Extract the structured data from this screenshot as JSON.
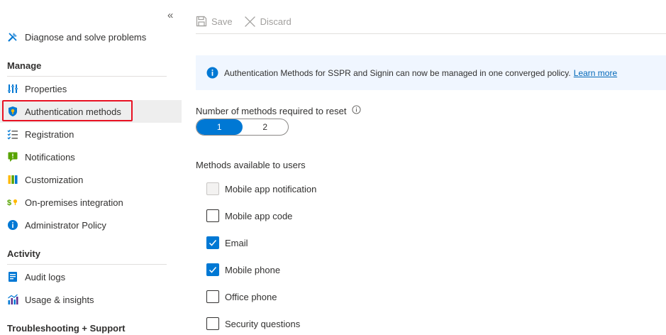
{
  "sidebar": {
    "items": [
      {
        "label": "Diagnose and solve problems",
        "icon": "diagnose-icon"
      },
      {
        "label": "Properties",
        "icon": "properties-icon"
      },
      {
        "label": "Authentication methods",
        "icon": "shield-key-icon",
        "selected": true
      },
      {
        "label": "Registration",
        "icon": "registration-list-icon"
      },
      {
        "label": "Notifications",
        "icon": "notification-icon"
      },
      {
        "label": "Customization",
        "icon": "customization-icon"
      },
      {
        "label": "On-premises integration",
        "icon": "on-premises-integration-icon"
      },
      {
        "label": "Administrator Policy",
        "icon": "info-icon"
      },
      {
        "label": "Audit logs",
        "icon": "audit-logs-icon"
      },
      {
        "label": "Usage & insights",
        "icon": "usage-insights-icon"
      }
    ],
    "sections": {
      "manage": "Manage",
      "activity": "Activity",
      "troubleshooting": "Troubleshooting + Support"
    },
    "collapse_glyph": "«"
  },
  "toolbar": {
    "save_label": "Save",
    "discard_label": "Discard"
  },
  "info_bar": {
    "message": "Authentication Methods for SSPR and Signin can now be managed in one converged policy.",
    "link": "Learn more"
  },
  "methods_required": {
    "label": "Number of methods required to reset",
    "options": [
      "1",
      "2"
    ],
    "selected": "1"
  },
  "methods_available": {
    "label": "Methods available to users",
    "items": [
      {
        "label": "Mobile app notification",
        "checked": false,
        "disabled": true
      },
      {
        "label": "Mobile app code",
        "checked": false,
        "disabled": false
      },
      {
        "label": "Email",
        "checked": true,
        "disabled": false
      },
      {
        "label": "Mobile phone",
        "checked": true,
        "disabled": false
      },
      {
        "label": "Office phone",
        "checked": false,
        "disabled": false
      },
      {
        "label": "Security questions",
        "checked": false,
        "disabled": false
      }
    ]
  },
  "colors": {
    "accent": "#0078d4",
    "highlight": "#e81123",
    "info_bg": "#f0f6ff"
  }
}
